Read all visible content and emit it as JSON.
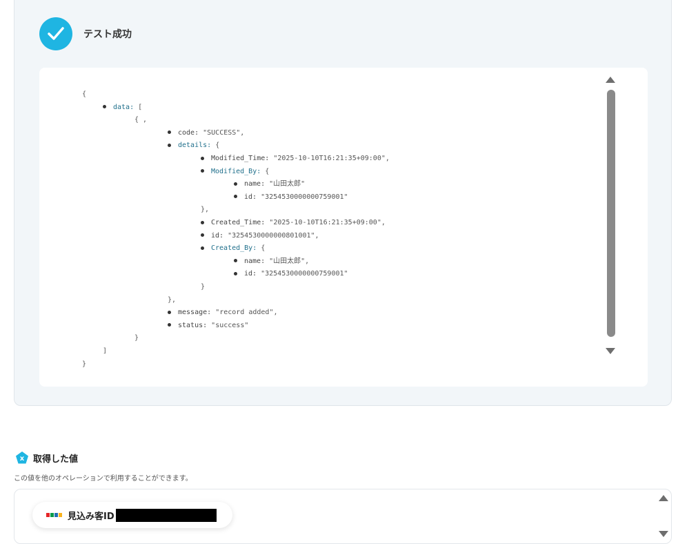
{
  "test_result": {
    "title": "テスト成功",
    "json_lines": [
      {
        "indent": 0,
        "bullet": false,
        "key": "",
        "key_style": "key",
        "text": "{"
      },
      {
        "indent": 1,
        "bullet": true,
        "key": "data: ",
        "key_style": "key-obj",
        "text": "["
      },
      {
        "indent": 2,
        "bullet": false,
        "key": "",
        "key_style": "key",
        "text": "{ ,"
      },
      {
        "indent": 3,
        "bullet": true,
        "key": "code: ",
        "key_style": "key",
        "text": "\"SUCCESS\","
      },
      {
        "indent": 3,
        "bullet": true,
        "key": "details: ",
        "key_style": "key-obj",
        "text": "{"
      },
      {
        "indent": 4,
        "bullet": true,
        "key": "Modified_Time: ",
        "key_style": "key",
        "text": "\"2025-10-10T16:21:35+09:00\","
      },
      {
        "indent": 4,
        "bullet": true,
        "key": "Modified_By: ",
        "key_style": "key-obj",
        "text": "{"
      },
      {
        "indent": 5,
        "bullet": true,
        "key": "name: ",
        "key_style": "key",
        "text": "\"山田太郎\""
      },
      {
        "indent": 5,
        "bullet": true,
        "key": "id: ",
        "key_style": "key",
        "text": "\"3254530000000759001\""
      },
      {
        "indent": 4,
        "bullet": false,
        "key": "",
        "key_style": "key",
        "text": "},"
      },
      {
        "indent": 4,
        "bullet": true,
        "key": "Created_Time: ",
        "key_style": "key",
        "text": "\"2025-10-10T16:21:35+09:00\","
      },
      {
        "indent": 4,
        "bullet": true,
        "key": "id: ",
        "key_style": "key",
        "text": "\"3254530000000801001\","
      },
      {
        "indent": 4,
        "bullet": true,
        "key": "Created_By: ",
        "key_style": "key-obj",
        "text": "{"
      },
      {
        "indent": 5,
        "bullet": true,
        "key": "name: ",
        "key_style": "key",
        "text": "\"山田太郎\","
      },
      {
        "indent": 5,
        "bullet": true,
        "key": "id: ",
        "key_style": "key",
        "text": "\"3254530000000759001\""
      },
      {
        "indent": 4,
        "bullet": false,
        "key": "",
        "key_style": "key",
        "text": "}"
      },
      {
        "indent": 3,
        "bullet": false,
        "key": "",
        "key_style": "key",
        "text": "},"
      },
      {
        "indent": 3,
        "bullet": true,
        "key": "message: ",
        "key_style": "key",
        "text": "\"record added\","
      },
      {
        "indent": 3,
        "bullet": true,
        "key": "status: ",
        "key_style": "key",
        "text": "\"success\""
      },
      {
        "indent": 2,
        "bullet": false,
        "key": "",
        "key_style": "key",
        "text": "}"
      },
      {
        "indent": 1,
        "bullet": false,
        "key": "",
        "key_style": "key",
        "text": "]"
      },
      {
        "indent": 0,
        "bullet": false,
        "key": "",
        "key_style": "key",
        "text": "}"
      }
    ]
  },
  "obtained_values": {
    "title": "取得した値",
    "description": "この値を他のオペレーションで利用することができます。",
    "items": [
      {
        "label": "見込み客ID",
        "value_redacted": true
      }
    ]
  },
  "colors": {
    "accent": "#1fb5e2",
    "card_bg": "#f2f6f9",
    "json_key_obj": "#1f6f8b"
  }
}
